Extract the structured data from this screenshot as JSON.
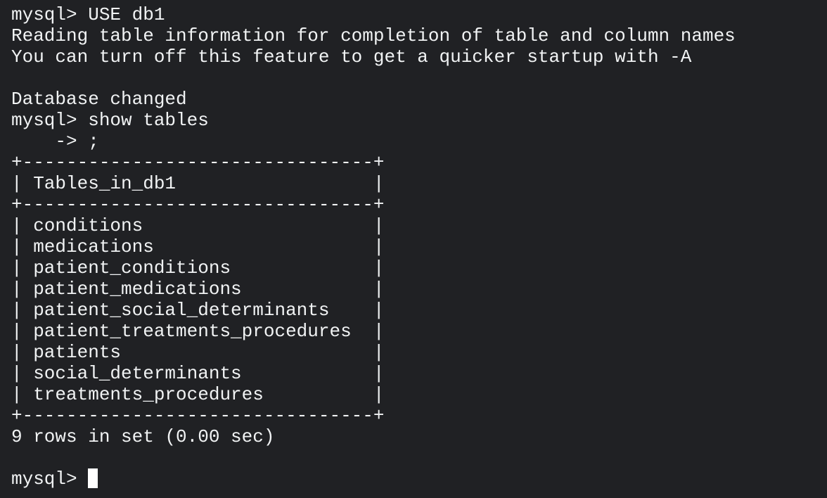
{
  "terminal": {
    "lines": [
      "mysql> USE db1",
      "Reading table information for completion of table and column names",
      "You can turn off this feature to get a quicker startup with -A",
      "",
      "Database changed",
      "mysql> show tables",
      "    -> ;",
      "+--------------------------------+",
      "| Tables_in_db1                  |",
      "+--------------------------------+",
      "| conditions                     |",
      "| medications                    |",
      "| patient_conditions             |",
      "| patient_medications            |",
      "| patient_social_determinants    |",
      "| patient_treatments_procedures  |",
      "| patients                       |",
      "| social_determinants            |",
      "| treatments_procedures          |",
      "+--------------------------------+",
      "9 rows in set (0.00 sec)",
      "",
      "mysql> "
    ]
  }
}
